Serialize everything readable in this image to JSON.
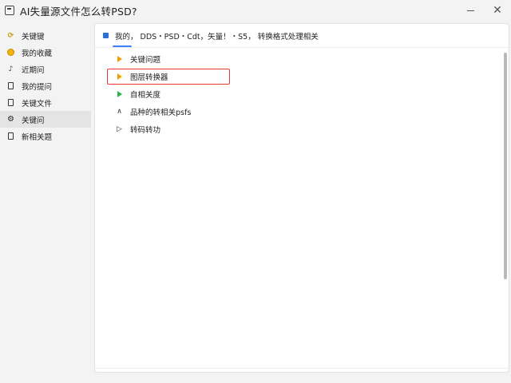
{
  "window": {
    "title": "AI失量源文件怎么转PSD?"
  },
  "sidebar": {
    "items": [
      {
        "label": "关键键",
        "icon": "sync-icon"
      },
      {
        "label": "我的收藏",
        "icon": "circle-icon"
      },
      {
        "label": "近期问",
        "icon": "music-icon"
      },
      {
        "label": "我的提问",
        "icon": "document-icon"
      },
      {
        "label": "关键文件",
        "icon": "document-icon"
      },
      {
        "label": "关键问",
        "icon": "gear-icon",
        "active": true
      },
      {
        "label": "新相关题",
        "icon": "document-icon"
      }
    ]
  },
  "main": {
    "header_text": "我的，  DDS・PSD・Cdt，矢量！・S5，  转换格式处理相关",
    "list": [
      {
        "label": "关键问题",
        "icon": "orange-triangle-icon"
      },
      {
        "label": "图层转换器",
        "icon": "orange-triangle-icon",
        "highlighted": true
      },
      {
        "label": "自相关度",
        "icon": "green-triangle-icon"
      },
      {
        "label": "品种的转相关psfs",
        "icon": "caret-icon"
      },
      {
        "label": "转码转功",
        "icon": "outline-triangle-icon"
      }
    ]
  },
  "colors": {
    "accent": "#3b82f6",
    "highlight": "#e53935",
    "orange": "#f0a000",
    "green": "#2bb34a"
  }
}
